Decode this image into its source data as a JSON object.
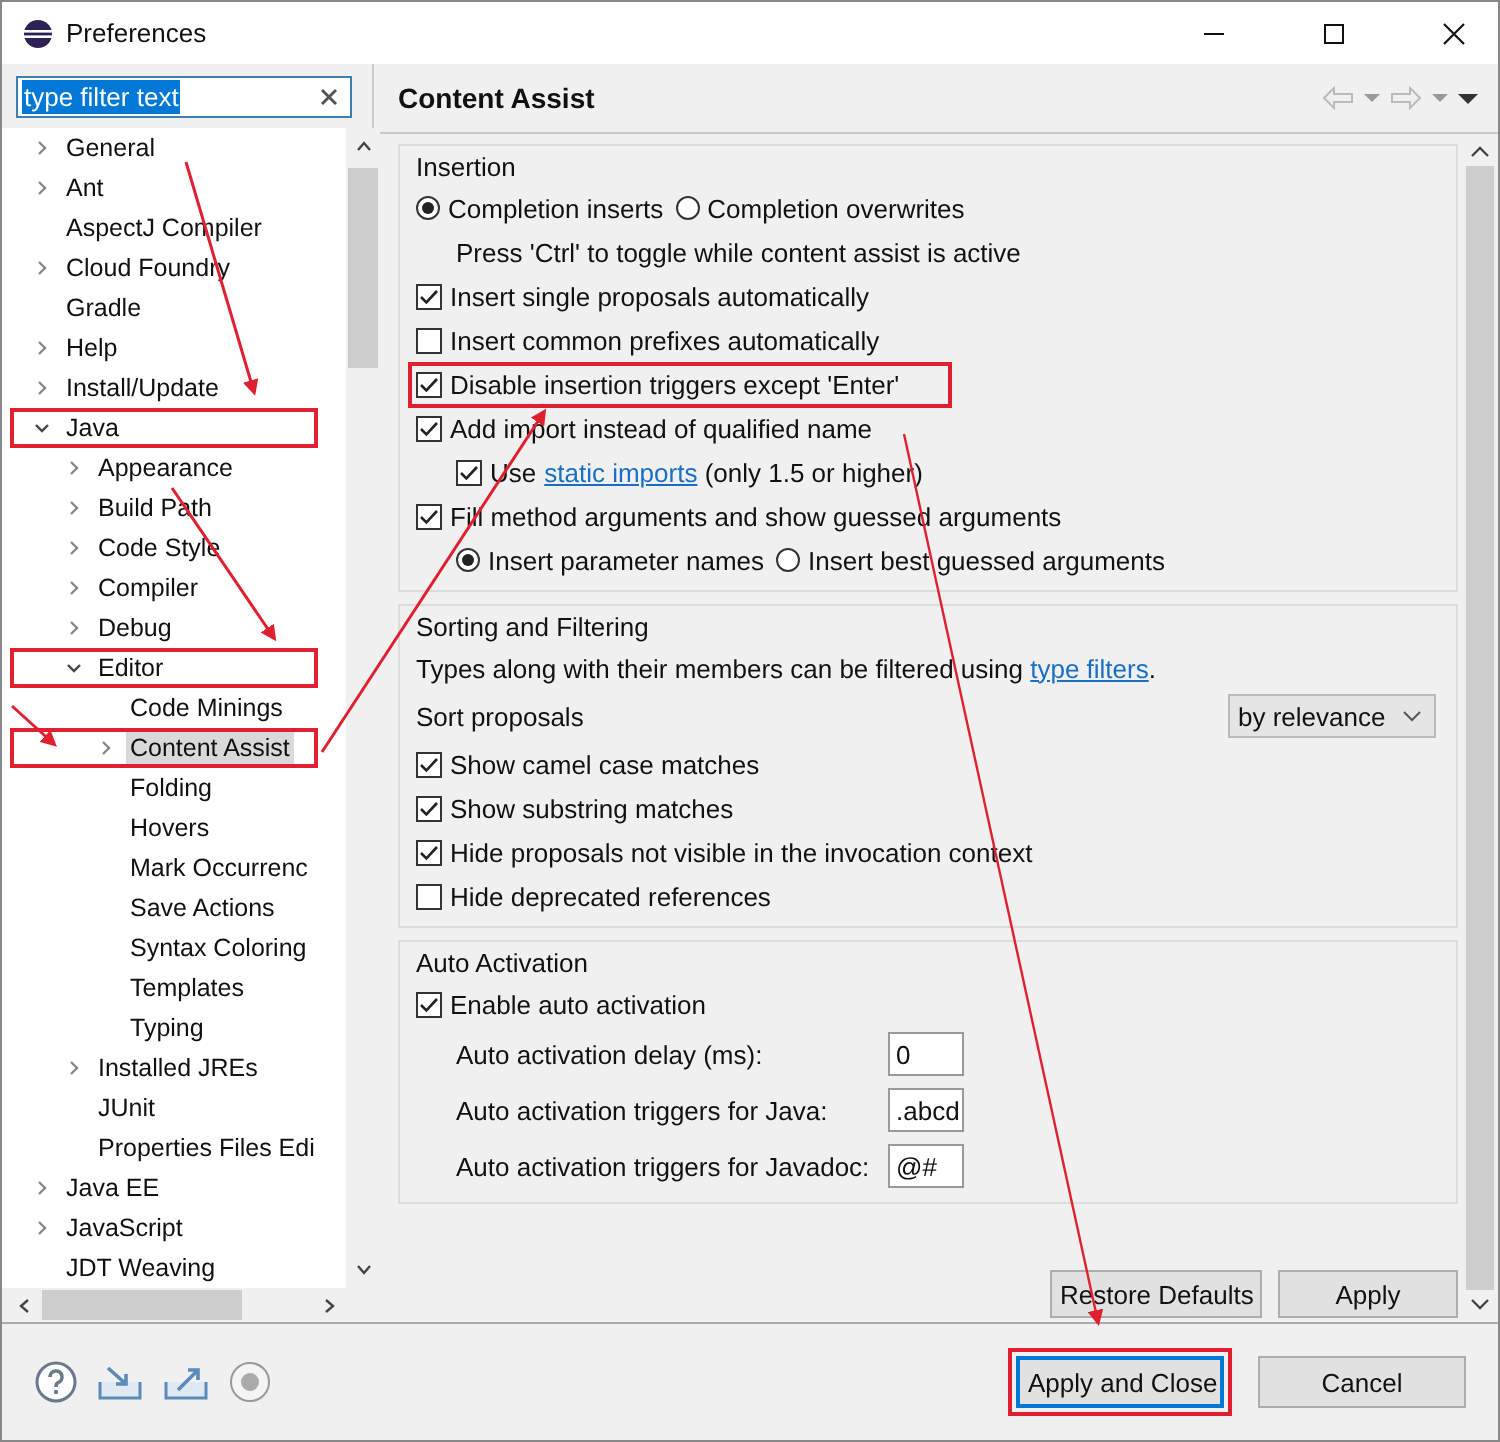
{
  "window": {
    "title": "Preferences"
  },
  "filter": {
    "value": "type filter text",
    "selected": true
  },
  "tree": [
    {
      "label": "General",
      "expanded": false,
      "selected": false,
      "highlighted": false
    },
    {
      "label": "Ant",
      "expanded": false,
      "selected": false,
      "highlighted": false
    },
    {
      "label": "AspectJ Compiler",
      "selected": false,
      "highlighted": false
    },
    {
      "label": "Cloud Foundry",
      "expanded": false,
      "selected": false,
      "highlighted": false
    },
    {
      "label": "Gradle",
      "selected": false,
      "highlighted": false
    },
    {
      "label": "Help",
      "expanded": false,
      "selected": false,
      "highlighted": false
    },
    {
      "label": "Install/Update",
      "expanded": false,
      "selected": false,
      "highlighted": false
    },
    {
      "label": "Java",
      "expanded": true,
      "selected": false,
      "highlighted": true,
      "children": [
        {
          "label": "Appearance",
          "expanded": false,
          "selected": false,
          "highlighted": false
        },
        {
          "label": "Build Path",
          "expanded": false,
          "selected": false,
          "highlighted": false
        },
        {
          "label": "Code Style",
          "expanded": false,
          "selected": false,
          "highlighted": false
        },
        {
          "label": "Compiler",
          "expanded": false,
          "selected": false,
          "highlighted": false
        },
        {
          "label": "Debug",
          "expanded": false,
          "selected": false,
          "highlighted": false
        },
        {
          "label": "Editor",
          "expanded": true,
          "selected": false,
          "highlighted": true,
          "children": [
            {
              "label": "Code Minings",
              "selected": false,
              "highlighted": false
            },
            {
              "label": "Content Assist",
              "expanded": false,
              "selected": true,
              "highlighted": true
            },
            {
              "label": "Folding",
              "selected": false,
              "highlighted": false
            },
            {
              "label": "Hovers",
              "selected": false,
              "highlighted": false
            },
            {
              "label": "Mark Occurrenc",
              "selected": false,
              "highlighted": false
            },
            {
              "label": "Save Actions",
              "selected": false,
              "highlighted": false
            },
            {
              "label": "Syntax Coloring",
              "selected": false,
              "highlighted": false
            },
            {
              "label": "Templates",
              "selected": false,
              "highlighted": false
            },
            {
              "label": "Typing",
              "selected": false,
              "highlighted": false
            }
          ]
        },
        {
          "label": "Installed JREs",
          "expanded": false,
          "selected": false,
          "highlighted": false
        },
        {
          "label": "JUnit",
          "selected": false,
          "highlighted": false
        },
        {
          "label": "Properties Files Edi",
          "selected": false,
          "highlighted": false
        }
      ]
    },
    {
      "label": "Java EE",
      "expanded": false,
      "selected": false,
      "highlighted": false
    },
    {
      "label": "JavaScript",
      "expanded": false,
      "selected": false,
      "highlighted": false
    },
    {
      "label": "JDT Weaving",
      "selected": false,
      "highlighted": false
    }
  ],
  "page": {
    "title": "Content Assist"
  },
  "groups": [
    {
      "title": "Insertion",
      "items": [
        {
          "kind": "radios",
          "options": [
            {
              "label": "Completion inserts",
              "selected": true
            },
            {
              "label": "Completion overwrites",
              "selected": false
            }
          ]
        },
        {
          "kind": "note",
          "text": "Press 'Ctrl' to toggle while content assist is active"
        },
        {
          "kind": "checkbox",
          "label": "Insert single proposals automatically",
          "checked": true,
          "highlighted": false
        },
        {
          "kind": "checkbox",
          "label": "Insert common prefixes automatically",
          "checked": false,
          "highlighted": false
        },
        {
          "kind": "checkbox",
          "label": "Disable insertion triggers except 'Enter'",
          "checked": true,
          "highlighted": true
        },
        {
          "kind": "checkbox",
          "label": "Add import instead of qualified name",
          "checked": true,
          "highlighted": false,
          "children": [
            {
              "kind": "checkbox",
              "label": "Use",
              "link": "static imports",
              "after": "(only 1.5 or higher)",
              "checked": true,
              "highlighted": false
            }
          ]
        },
        {
          "kind": "checkbox",
          "label": "Fill method arguments and show guessed arguments",
          "checked": true,
          "highlighted": false,
          "children": [
            {
              "kind": "radios",
              "options": [
                {
                  "label": "Insert parameter names",
                  "selected": true
                },
                {
                  "label": "Insert best guessed arguments",
                  "selected": false
                }
              ]
            }
          ]
        }
      ]
    },
    {
      "title": "Sorting and Filtering",
      "items": [
        {
          "kind": "text",
          "text": "Types along with their members can be filtered using",
          "link": "type filters",
          "after": "."
        },
        {
          "kind": "select",
          "label": "Sort proposals",
          "value": "by relevance"
        },
        {
          "kind": "checkbox",
          "label": "Show camel case matches",
          "checked": true,
          "highlighted": false
        },
        {
          "kind": "checkbox",
          "label": "Show substring matches",
          "checked": true,
          "highlighted": false
        },
        {
          "kind": "checkbox",
          "label": "Hide proposals not visible in the invocation context",
          "checked": true,
          "highlighted": false
        },
        {
          "kind": "checkbox",
          "label": "Hide deprecated references",
          "checked": false,
          "highlighted": false
        }
      ]
    },
    {
      "title": "Auto Activation",
      "items": [
        {
          "kind": "checkbox",
          "label": "Enable auto activation",
          "checked": true,
          "highlighted": false
        },
        {
          "kind": "field",
          "label": "Auto activation delay (ms):",
          "value": "0"
        },
        {
          "kind": "field",
          "label": "Auto activation triggers for Java:",
          "value": ".abcd"
        },
        {
          "kind": "field",
          "label": "Auto activation triggers for Javadoc:",
          "value": "@#"
        }
      ]
    }
  ],
  "page_buttons": [
    {
      "label": "Restore Defaults"
    },
    {
      "label": "Apply"
    }
  ],
  "dialog_buttons": [
    {
      "label": "Apply and Close",
      "default": true,
      "highlighted": true
    },
    {
      "label": "Cancel",
      "default": false,
      "highlighted": false
    }
  ]
}
